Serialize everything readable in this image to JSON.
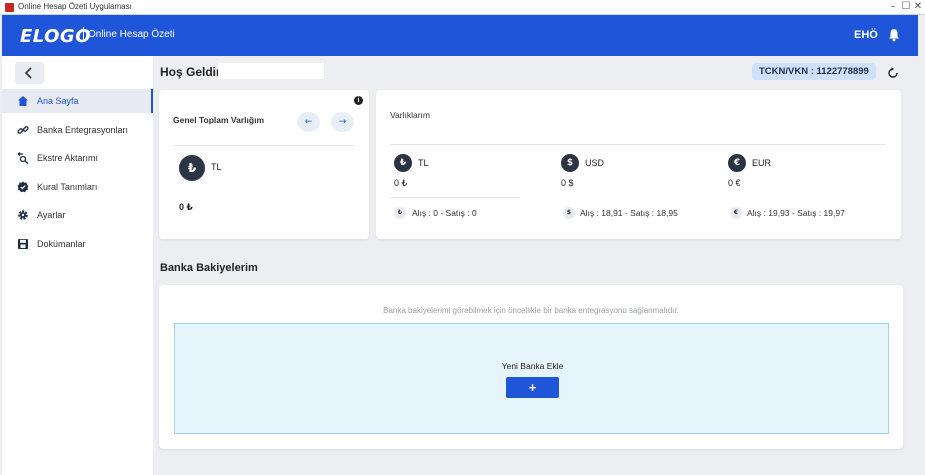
{
  "window": {
    "title": "Online Hesap Özeti Uygulaması",
    "controls": {
      "minimize": "–",
      "maximize": "☐",
      "close": "✕"
    }
  },
  "header": {
    "logo": "ELOGO",
    "app_title": "Online Hesap Özeti",
    "user_initials": "EHÖ",
    "brand_color": "#1f55d8"
  },
  "sidebar": {
    "back_icon": "chevron-left-icon",
    "items": [
      {
        "label": "Ana Sayfa",
        "icon": "home-icon",
        "active": true
      },
      {
        "label": "Banka Entegrasyonları",
        "icon": "link-icon",
        "active": false
      },
      {
        "label": "Ekstre Aktarımı",
        "icon": "transfer-icon",
        "active": false
      },
      {
        "label": "Kural Tanımları",
        "icon": "badge-check-icon",
        "active": false
      },
      {
        "label": "Ayarlar",
        "icon": "gear-icon",
        "active": false
      },
      {
        "label": "Dokümanlar",
        "icon": "save-icon",
        "active": false
      }
    ]
  },
  "main": {
    "welcome": "Hoş Geldin",
    "tckn": "TCKN/VKN : 1122778899",
    "total_card": {
      "title": "Genel Toplam Varlığım",
      "info": "i",
      "prev": "←",
      "next": "→",
      "currency_symbol": "₺",
      "currency_code": "TL",
      "amount": "0 ₺"
    },
    "assets_card": {
      "title": "Varlıklarım",
      "currencies": [
        {
          "symbol": "₺",
          "code": "TL",
          "amount": "0 ₺",
          "rate": "Alış : 0  -  Satış : 0"
        },
        {
          "symbol": "$",
          "code": "USD",
          "amount": "0 $",
          "rate": "Alış : 18,91  -  Satış : 18,95"
        },
        {
          "symbol": "€",
          "code": "EUR",
          "amount": "0 €",
          "rate": "Alış : 19,93  -  Satış : 19,97"
        }
      ]
    },
    "bank_balances": {
      "title": "Banka Bakiyelerim",
      "empty_message": "Banka bakiyelerimi görebilmek için öncellikle bir banka entegrasyonu sağlanmalıdır.",
      "add_label": "Yeni Banka Ekle",
      "add_button": "+"
    }
  }
}
